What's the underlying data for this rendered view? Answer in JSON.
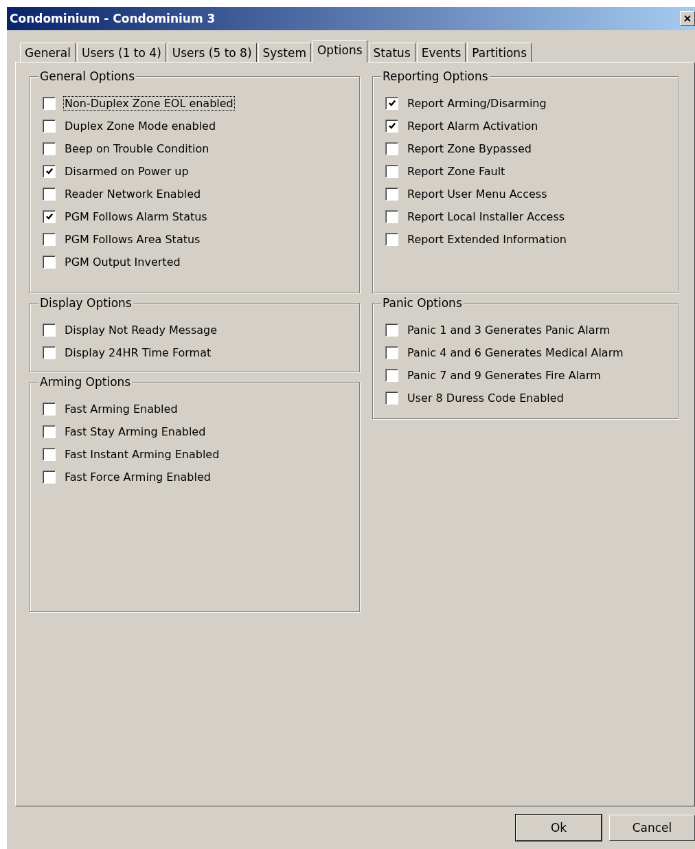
{
  "window": {
    "title": "Condominium - Condominium 3",
    "close": "×"
  },
  "tabs": [
    {
      "label": "General",
      "selected": false
    },
    {
      "label": "Users (1 to 4)",
      "selected": false
    },
    {
      "label": "Users (5 to 8)",
      "selected": false
    },
    {
      "label": "System",
      "selected": false
    },
    {
      "label": "Options",
      "selected": true
    },
    {
      "label": "Status",
      "selected": false
    },
    {
      "label": "Events",
      "selected": false
    },
    {
      "label": "Partitions",
      "selected": false
    }
  ],
  "left_groups": [
    {
      "title": "General Options",
      "options": [
        {
          "label": "Non-Duplex Zone EOL enabled",
          "checked": false,
          "focused": true
        },
        {
          "label": "Duplex Zone Mode enabled",
          "checked": false,
          "focused": false
        },
        {
          "label": "Beep on Trouble Condition",
          "checked": false,
          "focused": false
        },
        {
          "label": "Disarmed on Power up",
          "checked": true,
          "focused": false
        },
        {
          "label": "Reader Network Enabled",
          "checked": false,
          "focused": false
        },
        {
          "label": "PGM Follows Alarm Status",
          "checked": true,
          "focused": false
        },
        {
          "label": "PGM Follows Area Status",
          "checked": false,
          "focused": false
        },
        {
          "label": "PGM Output Inverted",
          "checked": false,
          "focused": false
        }
      ]
    },
    {
      "title": "Display Options",
      "options": [
        {
          "label": "Display Not Ready Message",
          "checked": false,
          "focused": false
        },
        {
          "label": "Display 24HR Time Format",
          "checked": false,
          "focused": false
        }
      ]
    },
    {
      "title": "Arming Options",
      "options": [
        {
          "label": "Fast Arming Enabled",
          "checked": false,
          "focused": false
        },
        {
          "label": "Fast Stay Arming Enabled",
          "checked": false,
          "focused": false
        },
        {
          "label": "Fast Instant Arming Enabled",
          "checked": false,
          "focused": false
        },
        {
          "label": "Fast Force Arming Enabled",
          "checked": false,
          "focused": false
        }
      ]
    }
  ],
  "right_groups": [
    {
      "title": "Reporting Options",
      "options": [
        {
          "label": "Report Arming/Disarming",
          "checked": true,
          "focused": false
        },
        {
          "label": "Report Alarm Activation",
          "checked": true,
          "focused": false
        },
        {
          "label": "Report Zone Bypassed",
          "checked": false,
          "focused": false
        },
        {
          "label": "Report Zone Fault",
          "checked": false,
          "focused": false
        },
        {
          "label": "Report User Menu Access",
          "checked": false,
          "focused": false
        },
        {
          "label": "Report Local Installer Access",
          "checked": false,
          "focused": false
        },
        {
          "label": "Report Extended Information",
          "checked": false,
          "focused": false
        }
      ]
    },
    {
      "title": "Panic Options",
      "options": [
        {
          "label": "Panic 1 and 3 Generates Panic Alarm",
          "checked": false,
          "focused": false
        },
        {
          "label": "Panic 4 and 6 Generates Medical Alarm",
          "checked": false,
          "focused": false
        },
        {
          "label": "Panic 7 and 9 Generates Fire Alarm",
          "checked": false,
          "focused": false
        },
        {
          "label": "User 8 Duress Code Enabled",
          "checked": false,
          "focused": false
        }
      ]
    }
  ],
  "buttons": [
    {
      "label": "Ok",
      "default": true
    },
    {
      "label": "Cancel",
      "default": false
    }
  ]
}
